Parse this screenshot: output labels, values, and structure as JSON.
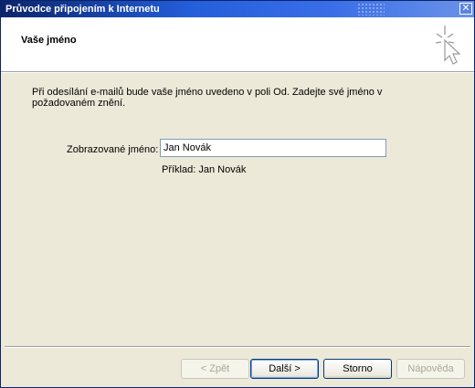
{
  "window": {
    "title": "Průvodce připojením k Internetu",
    "close_glyph": "✕"
  },
  "header": {
    "title": "Vaše jméno",
    "icon": "wizard-cursor-icon"
  },
  "content": {
    "description": "Při odesílání e-mailů bude vaše jméno uvedeno v poli Od. Zadejte své jméno v\npožadovaném znění.",
    "display_name_label": "Zobrazované jméno:",
    "display_name_value": "Jan Novák",
    "example": "Příklad: Jan Novák"
  },
  "buttons": {
    "back": "< Zpět",
    "next": "Další >",
    "cancel": "Storno",
    "help": "Nápověda"
  }
}
